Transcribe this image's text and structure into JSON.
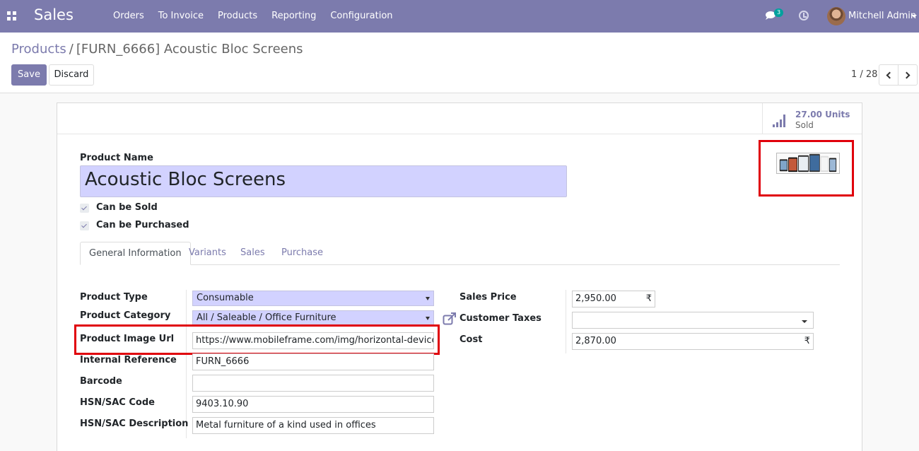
{
  "navbar": {
    "app_name": "Sales",
    "menu": [
      "Orders",
      "To Invoice",
      "Products",
      "Reporting",
      "Configuration"
    ],
    "chat_count": "3",
    "user_name": "Mitchell Admin",
    "color": "#7c7bad"
  },
  "breadcrumb": {
    "parent": "Products",
    "separator": "/",
    "current": "[FURN_6666] Acoustic Bloc Screens"
  },
  "buttons": {
    "save": "Save",
    "discard": "Discard"
  },
  "pager": {
    "value": "1 / 28"
  },
  "stat": {
    "value": "27.00 Units",
    "label": "Sold"
  },
  "form": {
    "name_label": "Product Name",
    "name_value": "Acoustic Bloc Screens",
    "can_be_sold": "Can be Sold",
    "can_be_purchased": "Can be Purchased"
  },
  "tabs": [
    "General Information",
    "Variants",
    "Sales",
    "Purchase"
  ],
  "left_fields": {
    "product_type": {
      "label": "Product Type",
      "value": "Consumable"
    },
    "product_category": {
      "label": "Product Category",
      "value": "All / Saleable / Office Furniture"
    },
    "image_url": {
      "label": "Product Image Url",
      "value": "https://www.mobileframe.com/img/horizontal-devices.png"
    },
    "internal_reference": {
      "label": "Internal Reference",
      "value": "FURN_6666"
    },
    "barcode": {
      "label": "Barcode",
      "value": ""
    },
    "hsn_code": {
      "label": "HSN/SAC Code",
      "value": "9403.10.90"
    },
    "hsn_description": {
      "label": "HSN/SAC Description",
      "value": "Metal furniture of a kind used in offices"
    }
  },
  "right_fields": {
    "sales_price": {
      "label": "Sales Price",
      "value": "2,950.00",
      "currency": "₹"
    },
    "customer_taxes": {
      "label": "Customer Taxes",
      "value": ""
    },
    "cost": {
      "label": "Cost",
      "value": "2,870.00",
      "currency": "₹"
    }
  },
  "highlight_color": "#e0000b"
}
